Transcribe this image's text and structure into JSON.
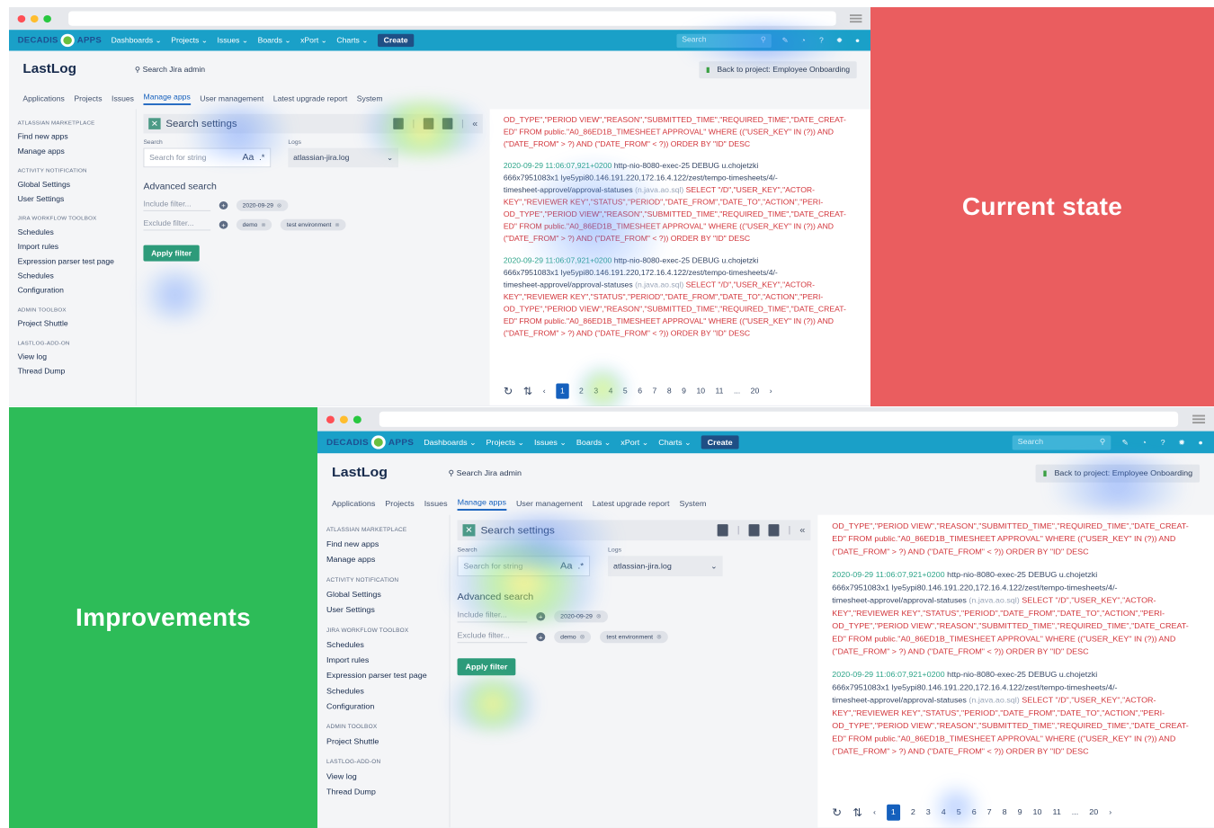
{
  "labels": {
    "current": "Current state",
    "improvements": "Improvements"
  },
  "nav": {
    "logo_left": "DECADIS",
    "logo_right": "APPS",
    "items": [
      "Dashboards ⌄",
      "Projects ⌄",
      "Issues ⌄",
      "Boards ⌄",
      "xPort ⌄",
      "Charts ⌄"
    ],
    "create": "Create",
    "search_placeholder": "Search"
  },
  "header": {
    "title": "LastLog",
    "jira_search": "Search Jira admin",
    "back": "Back to project: Employee Onboarding"
  },
  "tabs": [
    "Applications",
    "Projects",
    "Issues",
    "Manage apps",
    "User management",
    "Latest upgrade report",
    "System"
  ],
  "sidebar": {
    "s1": "ATLASSIAN MARKETPLACE",
    "find_apps": "Find new apps",
    "manage_apps": "Manage apps",
    "s2": "ACTIVITY NOTIFICATION",
    "global": "Global Settings",
    "user_settings": "User Settings",
    "s3": "JIRA WORKFLOW TOOLBOX",
    "schedules": "Schedules",
    "import": "Import rules",
    "expr": "Expression parser test page",
    "schedules2": "Schedules",
    "config": "Configuration",
    "s4": "ADMIN TOOLBOX",
    "shuttle": "Project Shuttle",
    "s5": "LASTLOG-ADD-ON",
    "viewlog": "View log",
    "thread": "Thread Dump"
  },
  "settings": {
    "title": "Search settings",
    "search_label": "Search",
    "search_placeholder": "Search for string",
    "case": "Aa",
    "regex": ".*",
    "logs_label": "Logs",
    "logs_value": "atlassian-jira.log",
    "advanced": "Advanced search",
    "include": "Include filter...",
    "exclude": "Exclude filter...",
    "tag_date": "2020-09-29",
    "tag_demo": "demo",
    "tag_env": "test environment",
    "apply": "Apply filter"
  },
  "log": {
    "head_line1": "OD_TYPE\",\"PERIOD VIEW\",\"REASON\",\"SUBMITTED_TIME\",\"REQUIRED_TIME\",\"DATE_CREAT-",
    "head_line2": "ED\" FROM public.\"A0_86ED1B_TIMESHEET APPROVAL\" WHERE ((\"USER_KEY\" IN (?)) AND",
    "head_line3": "(\"DATE_FROM\" > ?) AND (\"DATE_FROM\" < ?)) ORDER BY \"ID\" DESC",
    "ts": "2020-09-29 11:06:07,921+0200",
    "thread": "http-nio-8080-exec-25 DEBUG u.chojetzki",
    "line2": "666x7951083x1 lye5ypi80.146.191.220,172.16.4.122/zest/tempo-timesheets/4/-",
    "line3a": "timesheet-approvel/approval-statuses",
    "line3b": "(n.java.ao.sql)",
    "line3c": "SELECT \"/D\",\"USER_KEY\",\"ACTOR-",
    "line4": "KEY\",\"REVIEWER KEY\",\"STATUS\",\"PERIOD\",\"DATE_FROM\",\"DATE_TO\",\"ACTION\",\"PERI-",
    "line5": "OD_TYPE\",\"PERIOD VIEW\",\"REASON\",\"SUBMITTED_TIME\",\"REQUIRED_TIME\",\"DATE_CREAT-",
    "line6": "ED\" FROM public.\"A0_86ED1B_TIMESHEET APPROVAL\" WHERE ((\"USER_KEY\" IN (?)) AND",
    "line7": "(\"DATE_FROM\" > ?) AND (\"DATE_FROM\" < ?)) ORDER BY \"ID\" DESC"
  },
  "pager": {
    "pages": [
      "1",
      "2",
      "3",
      "4",
      "5",
      "6",
      "7",
      "8",
      "9",
      "10",
      "11",
      "...",
      "20"
    ],
    "current": "1"
  }
}
